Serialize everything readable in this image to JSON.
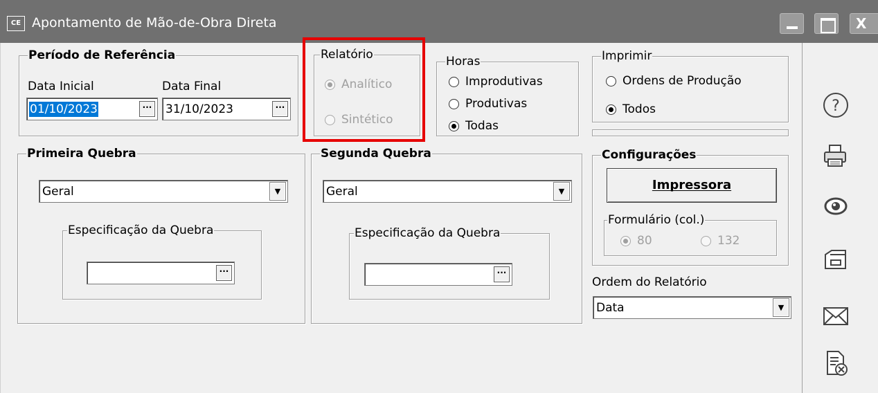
{
  "window": {
    "app_badge": "CE",
    "title": "Apontamento de Mão-de-Obra Direta",
    "minimize": "_",
    "maximize": "□",
    "close": "X"
  },
  "periodo": {
    "legend": "Período de Referência",
    "data_inicial_label": "Data Inicial",
    "data_inicial_value": "01/10/2023",
    "data_final_label": "Data Final",
    "data_final_value": "31/10/2023",
    "ellipsis": "···"
  },
  "relatorio": {
    "legend": "Relatório",
    "options": [
      "Analítico",
      "Sintético"
    ],
    "selected": "Analítico",
    "disabled": true
  },
  "horas": {
    "legend": "Horas",
    "options": [
      "Improdutivas",
      "Produtivas",
      "Todas"
    ],
    "selected": "Todas"
  },
  "imprimir": {
    "legend": "Imprimir",
    "options": [
      "Ordens de Produção",
      "Todos"
    ],
    "selected": "Todos"
  },
  "primeira_quebra": {
    "legend": "Primeira Quebra",
    "value": "Geral",
    "spec_legend": "Especificação da Quebra",
    "spec_value": ""
  },
  "segunda_quebra": {
    "legend": "Segunda Quebra",
    "value": "Geral",
    "spec_legend": "Especificação da Quebra",
    "spec_value": ""
  },
  "configuracoes": {
    "legend": "Configurações",
    "impressora_button": "Impressora",
    "formulario_legend": "Formulário (col.)",
    "formulario_options": [
      "80",
      "132"
    ],
    "formulario_selected": "80"
  },
  "ordem": {
    "label": "Ordem do Relatório",
    "value": "Data"
  },
  "toolbar": {
    "icons": [
      "help-icon",
      "printer-icon",
      "preview-eye-icon",
      "export-file-icon",
      "email-icon",
      "cancel-document-icon"
    ]
  },
  "colors": {
    "titlebar": "#707070",
    "selection": "#0078d7",
    "highlight_border": "#e60000"
  }
}
